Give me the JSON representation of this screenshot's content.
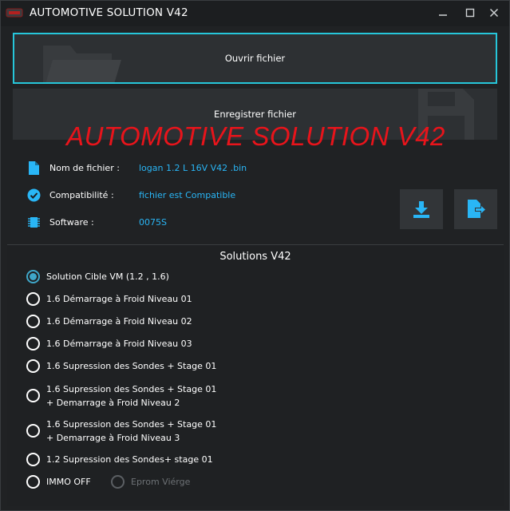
{
  "window": {
    "title": "AUTOMOTIVE SOLUTION  V42",
    "controls": [
      "minimize-icon",
      "maximize-icon",
      "close-icon"
    ]
  },
  "file_buttons": {
    "open_label": "Ouvrir fichier",
    "save_label": "Enregistrer fichier"
  },
  "watermark": "AUTOMOTIVE SOLUTION V42",
  "info": {
    "filename_label": "Nom de fichier :",
    "filename_value": "logan 1.2 L 16V V42 .bin",
    "compat_label": "Compatibilité :",
    "compat_value": "fichier est Compatible",
    "software_label": "Software :",
    "software_value": "0075S"
  },
  "actions": [
    "download-icon",
    "export-file-icon"
  ],
  "solutions": {
    "title": "Solutions V42",
    "options": [
      {
        "line1": "Solution Cible VM (1.2 , 1.6)",
        "line2": "",
        "selected": true
      },
      {
        "line1": "1.6 Démarrage à Froid Niveau 01",
        "line2": "",
        "selected": false
      },
      {
        "line1": "1.6 Démarrage à Froid Niveau 02",
        "line2": "",
        "selected": false
      },
      {
        "line1": "1.6 Démarrage à Froid Niveau 03",
        "line2": "",
        "selected": false
      },
      {
        "line1": "1.6 Supression des Sondes + Stage 01",
        "line2": "",
        "selected": false
      },
      {
        "line1": "1.6 Supression des Sondes + Stage 01",
        "line2": "+ Demarrage à Froid Niveau 2",
        "selected": false
      },
      {
        "line1": "1.6 Supression des Sondes + Stage 01",
        "line2": "+ Demarrage à Froid Niveau 3",
        "selected": false
      },
      {
        "line1": "1.2 Supression des Sondes+ stage 01",
        "line2": "",
        "selected": false
      }
    ],
    "immo_label": "IMMO OFF",
    "eprom_label": "Eprom Viérge"
  },
  "colors": {
    "accent": "#26c6da",
    "value_text": "#29b6f6",
    "watermark": "#e8141b",
    "background": "#202224"
  }
}
